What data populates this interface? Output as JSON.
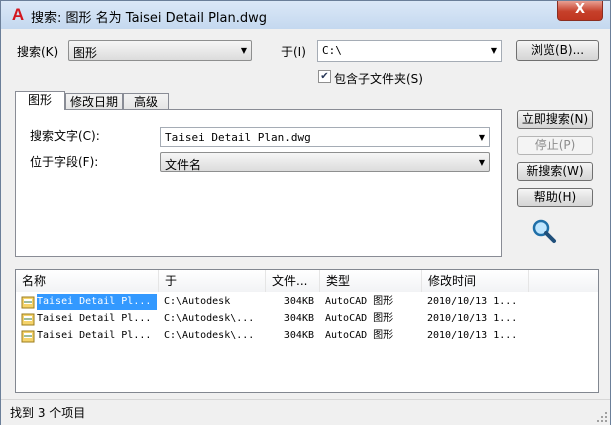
{
  "window": {
    "title": "搜索: 图形 名为 Taisei Detail Plan.dwg",
    "close_glyph": "X"
  },
  "search": {
    "search_label": "搜索(K)",
    "search_value": "图形",
    "in_label": "于(I)",
    "in_value": "C:\\",
    "browse_button": "浏览(B)...",
    "include_subfolders_label": "包含子文件夹(S)",
    "include_subfolders_checked": true
  },
  "tabs": [
    {
      "label": "图形",
      "active": true
    },
    {
      "label": "修改日期",
      "active": false
    },
    {
      "label": "高级",
      "active": false
    }
  ],
  "drawing_tab": {
    "search_text_label": "搜索文字(C):",
    "search_text_value": "Taisei Detail Plan.dwg",
    "field_label": "位于字段(F):",
    "field_value": "文件名"
  },
  "actions": {
    "search_now": "立即搜索(N)",
    "stop": "停止(P)",
    "new_search": "新搜索(W)",
    "help": "帮助(H)"
  },
  "results": {
    "columns": [
      "名称",
      "于",
      "文件...",
      "类型",
      "修改时间"
    ],
    "rows": [
      {
        "name": "Taisei Detail Pl...",
        "location": "C:\\Autodesk",
        "size": "304KB",
        "type": "AutoCAD 图形",
        "modified": "2010/10/13 1...",
        "selected": true
      },
      {
        "name": "Taisei Detail Pl...",
        "location": "C:\\Autodesk\\...",
        "size": "304KB",
        "type": "AutoCAD 图形",
        "modified": "2010/10/13 1...",
        "selected": false
      },
      {
        "name": "Taisei Detail Pl...",
        "location": "C:\\Autodesk\\...",
        "size": "304KB",
        "type": "AutoCAD 图形",
        "modified": "2010/10/13 1...",
        "selected": false
      }
    ]
  },
  "status": {
    "text": "找到 3 个项目"
  },
  "icons": {
    "app": "autocad-a-icon",
    "search_animation": "magnifier-icon",
    "dropdown": "chevron-down-icon",
    "file": "dwg-file-icon"
  },
  "colors": {
    "selection": "#3399ff",
    "close_button": "#c6402a",
    "app_icon": "#d3161e"
  }
}
